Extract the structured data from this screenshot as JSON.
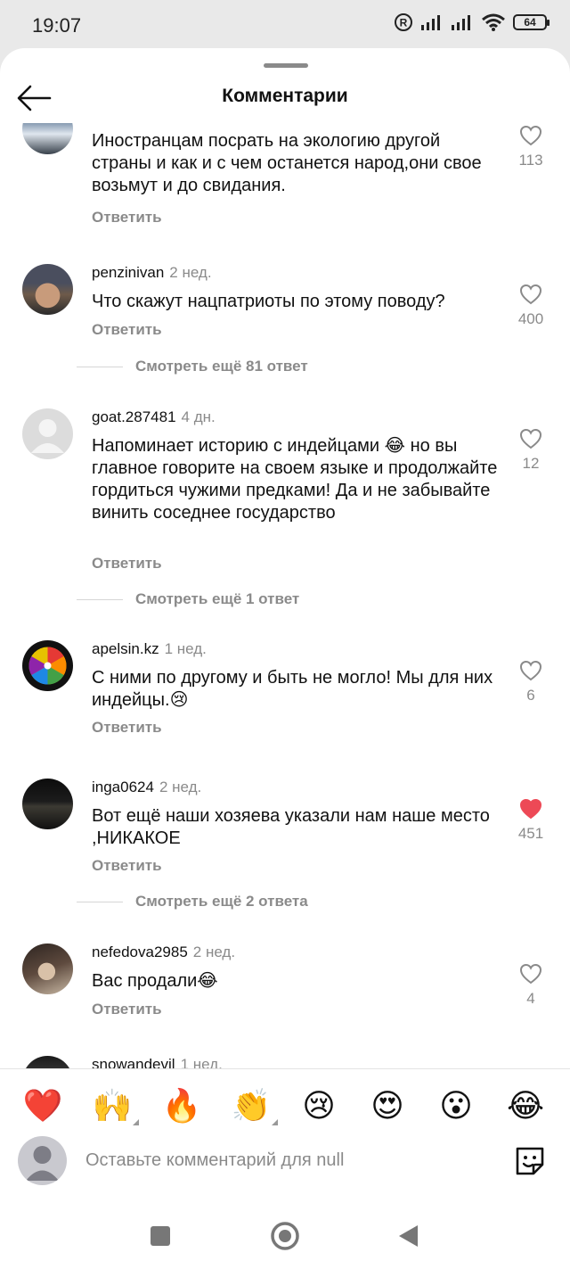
{
  "status_bar": {
    "time": "19:07",
    "battery": "64",
    "icons": [
      "registered-icon",
      "signal-icon",
      "signal-icon",
      "wifi-icon",
      "battery-icon"
    ]
  },
  "header": {
    "title": "Комментарии",
    "back_icon": "arrow-left-icon"
  },
  "comments": [
    {
      "username": "",
      "time": "",
      "text": "Иностранцам посрать на экологию другой страны и как и с чем останется народ,они свое возьмут и до свидания.",
      "reply_label": "Ответить",
      "likes": "113",
      "liked": false,
      "avatar_icon": "winter-landscape-avatar"
    },
    {
      "username": "penzinivan",
      "time": "2 нед.",
      "text": "Что скажут нацпатриоты по этому поводу?",
      "reply_label": "Ответить",
      "likes": "400",
      "liked": false,
      "avatar_icon": "man-in-hat-avatar",
      "more_replies": "Смотреть ещё 81 ответ"
    },
    {
      "username": "goat.287481",
      "time": "4 дн.",
      "text": "Напоминает историю с индейцами 😂 но вы главное говорите на своем языке и продолжайте гордиться чужими предками! Да и не забывайте винить соседнее государство",
      "reply_label": "Ответить",
      "likes": "12",
      "liked": false,
      "avatar_icon": "default-avatar",
      "more_replies": "Смотреть ещё 1 ответ"
    },
    {
      "username": "apelsin.kz",
      "time": "1 нед.",
      "text": "С ними по другому и быть не могло! Мы для них индейцы.😢",
      "reply_label": "Ответить",
      "likes": "6",
      "liked": false,
      "avatar_icon": "color-wheel-logo-avatar"
    },
    {
      "username": "inga0624",
      "time": "2 нед.",
      "text": "Вот ещё наши хозяева указали нам наше место ,НИКАКОЕ",
      "reply_label": "Ответить",
      "likes": "451",
      "liked": true,
      "avatar_icon": "night-water-avatar",
      "more_replies": "Смотреть ещё 2 ответа"
    },
    {
      "username": "nefedova2985",
      "time": "2 нед.",
      "text": "Вас продали😂",
      "reply_label": "Ответить",
      "likes": "4",
      "liked": false,
      "avatar_icon": "woman-portrait-avatar"
    },
    {
      "username": "snowandevil",
      "time": "1 нед.",
      "avatar_icon": "dark-landscape-avatar"
    }
  ],
  "reactions": [
    "❤️",
    "🙌",
    "🔥",
    "👏",
    "😢",
    "😍",
    "😮",
    "😂"
  ],
  "composer": {
    "placeholder": "Оставьте комментарий для null",
    "sticker_icon": "sticker-icon"
  },
  "nav": {
    "icons": [
      "recents-square-icon",
      "home-circle-icon",
      "back-triangle-icon"
    ]
  },
  "colors": {
    "like_active": "#ed4956",
    "muted_text": "#8a8a8a",
    "background": "#ffffff"
  }
}
